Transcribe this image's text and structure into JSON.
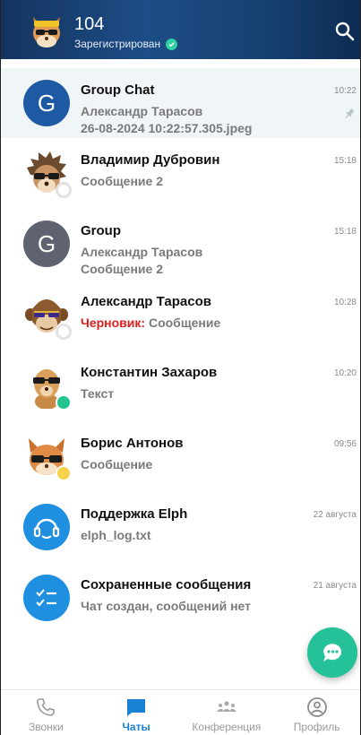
{
  "header": {
    "title": "104",
    "status": "Зарегистрирован",
    "avatar_icon": "cat-sunglasses-avatar",
    "search_icon": "search-icon"
  },
  "chats": [
    {
      "name": "Group Chat",
      "line2": "Александр Тарасов",
      "line3": "26-08-2024 10:22:57.305.jpeg",
      "time": "10:22",
      "avatar_letter": "G",
      "avatar_color": "#1e5aa3",
      "pinned": true
    },
    {
      "name": "Владимир Дубровин",
      "line2": "Сообщение 2",
      "time": "15:18",
      "avatar_icon": "hedgehog-sunglasses-avatar",
      "status": "offline"
    },
    {
      "name": "Group",
      "line2": "Александр Тарасов",
      "line3": "Сообщение 2",
      "time": "15:18",
      "avatar_letter": "G",
      "avatar_color": "#5f6270"
    },
    {
      "name": "Александр Тарасов",
      "draft_label": "Черновик:",
      "line2": " Сообщение",
      "time": "10:28",
      "avatar_icon": "monkey-sunglasses-avatar",
      "status": "offline"
    },
    {
      "name": "Константин Захаров",
      "line2": "Текст",
      "time": "10:20",
      "avatar_icon": "meerkat-sunglasses-avatar",
      "status": "online"
    },
    {
      "name": "Борис Антонов",
      "line2": "Сообщение",
      "time": "09:56",
      "avatar_icon": "cat-sunglasses-avatar",
      "status": "away"
    },
    {
      "name": "Поддержка Elph",
      "line2": "elph_log.txt",
      "time": "22 августа",
      "avatar_icon": "support-headset-icon",
      "avatar_color": "#1f8fe0"
    },
    {
      "name": "Сохраненные сообщения",
      "line2": "Чат создан, сообщений нет",
      "time": "21 августа",
      "avatar_icon": "saved-checklist-icon",
      "avatar_color": "#1f8fe0"
    }
  ],
  "fab": {
    "icon": "new-message-icon"
  },
  "nav": [
    {
      "label": "Звонки",
      "icon": "phone-icon",
      "active": false
    },
    {
      "label": "Чаты",
      "icon": "chat-icon",
      "active": true
    },
    {
      "label": "Конференция",
      "icon": "conference-icon",
      "active": false
    },
    {
      "label": "Профиль",
      "icon": "profile-icon",
      "active": false
    }
  ],
  "colors": {
    "header_dark": "#14345f",
    "accent": "#1a82d6",
    "fab": "#25c29a",
    "online": "#23c48f",
    "away": "#f7d24a",
    "draft": "#e21e1e",
    "pinned_bg": "#f0f5f7"
  }
}
